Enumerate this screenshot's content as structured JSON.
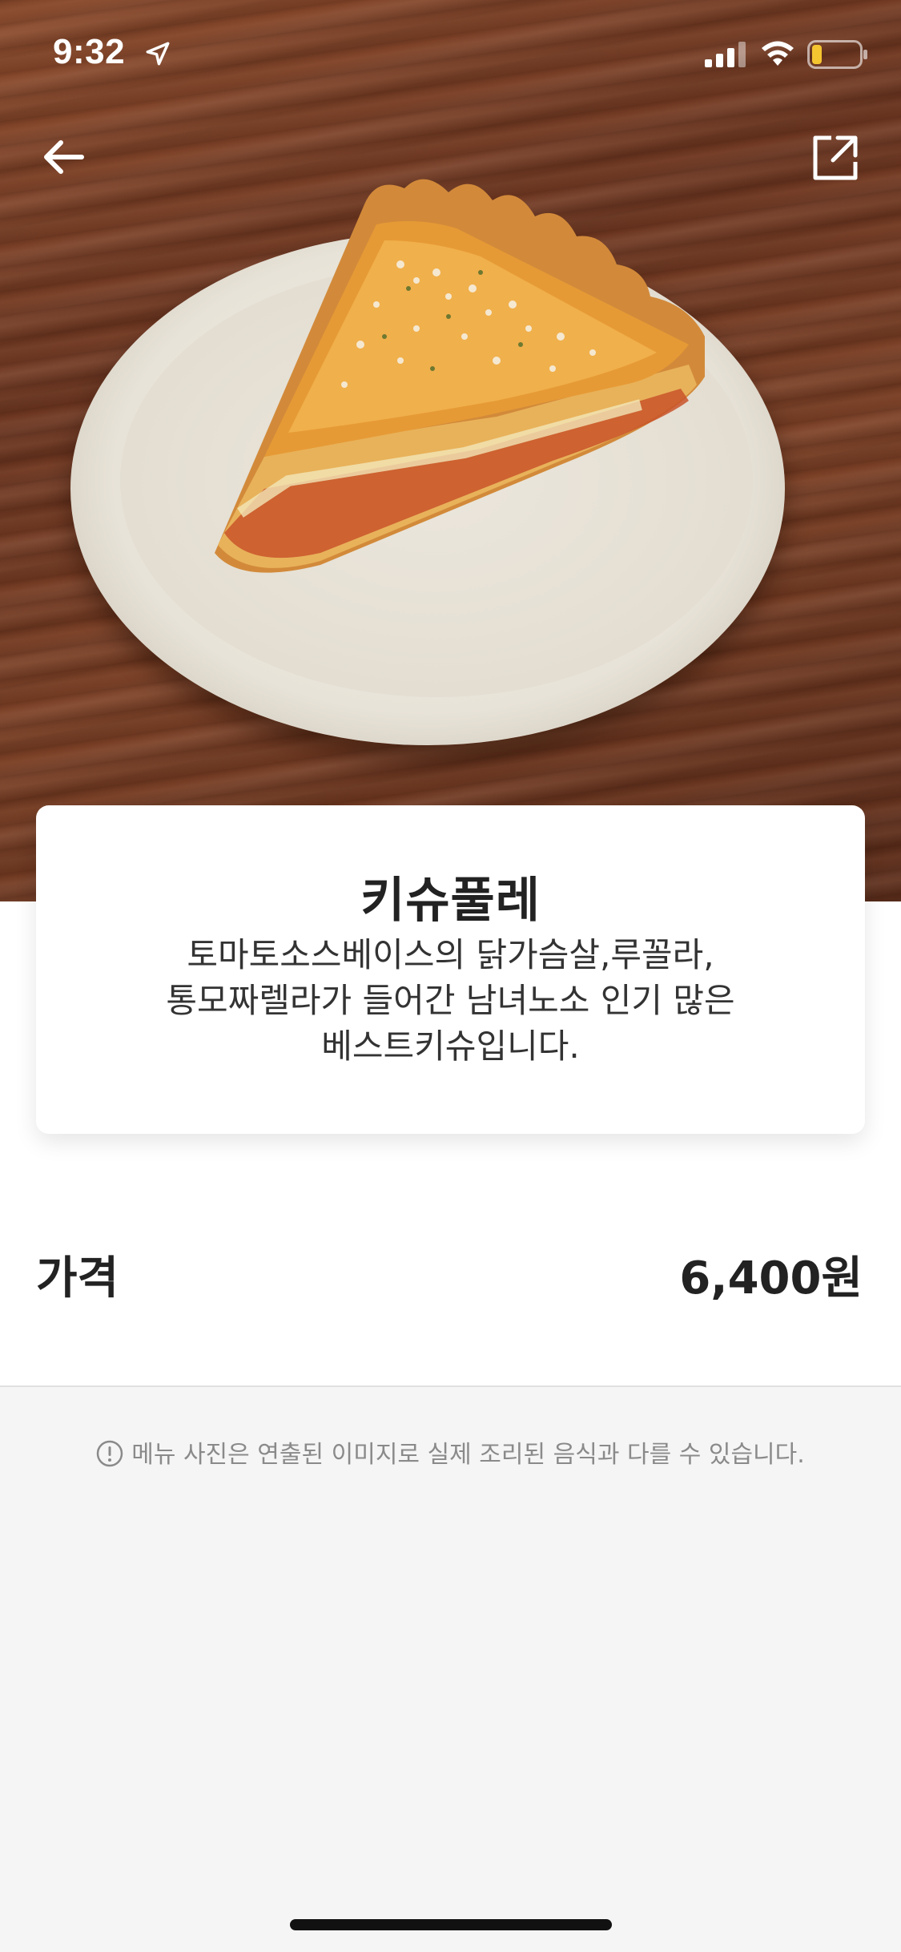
{
  "status_bar": {
    "time": "9:32",
    "icons": [
      "location-icon",
      "signal-icon",
      "wifi-icon",
      "battery-icon"
    ]
  },
  "nav": {
    "back_icon": "arrow-left-icon",
    "share_icon": "share-external-icon"
  },
  "hero": {
    "image": "quiche slice on plate"
  },
  "menu": {
    "name": "키슈풀레",
    "description": "토마토소스베이스의 닭가슴살,루꼴라,\n통모짜렐라가 들어간 남녀노소 인기 많은\n베스트키슈입니다."
  },
  "price": {
    "label": "가격",
    "value": "6,400원"
  },
  "notice": {
    "icon": "info-circle-icon",
    "text": "메뉴 사진은 연출된 이미지로 실제 조리된 음식과 다를 수 있습니다."
  },
  "colors": {
    "background": "#f5f5f5",
    "card": "#ffffff",
    "text_primary": "#222222",
    "text_muted": "#8a8a8a",
    "battery_low": "#f5c531"
  }
}
